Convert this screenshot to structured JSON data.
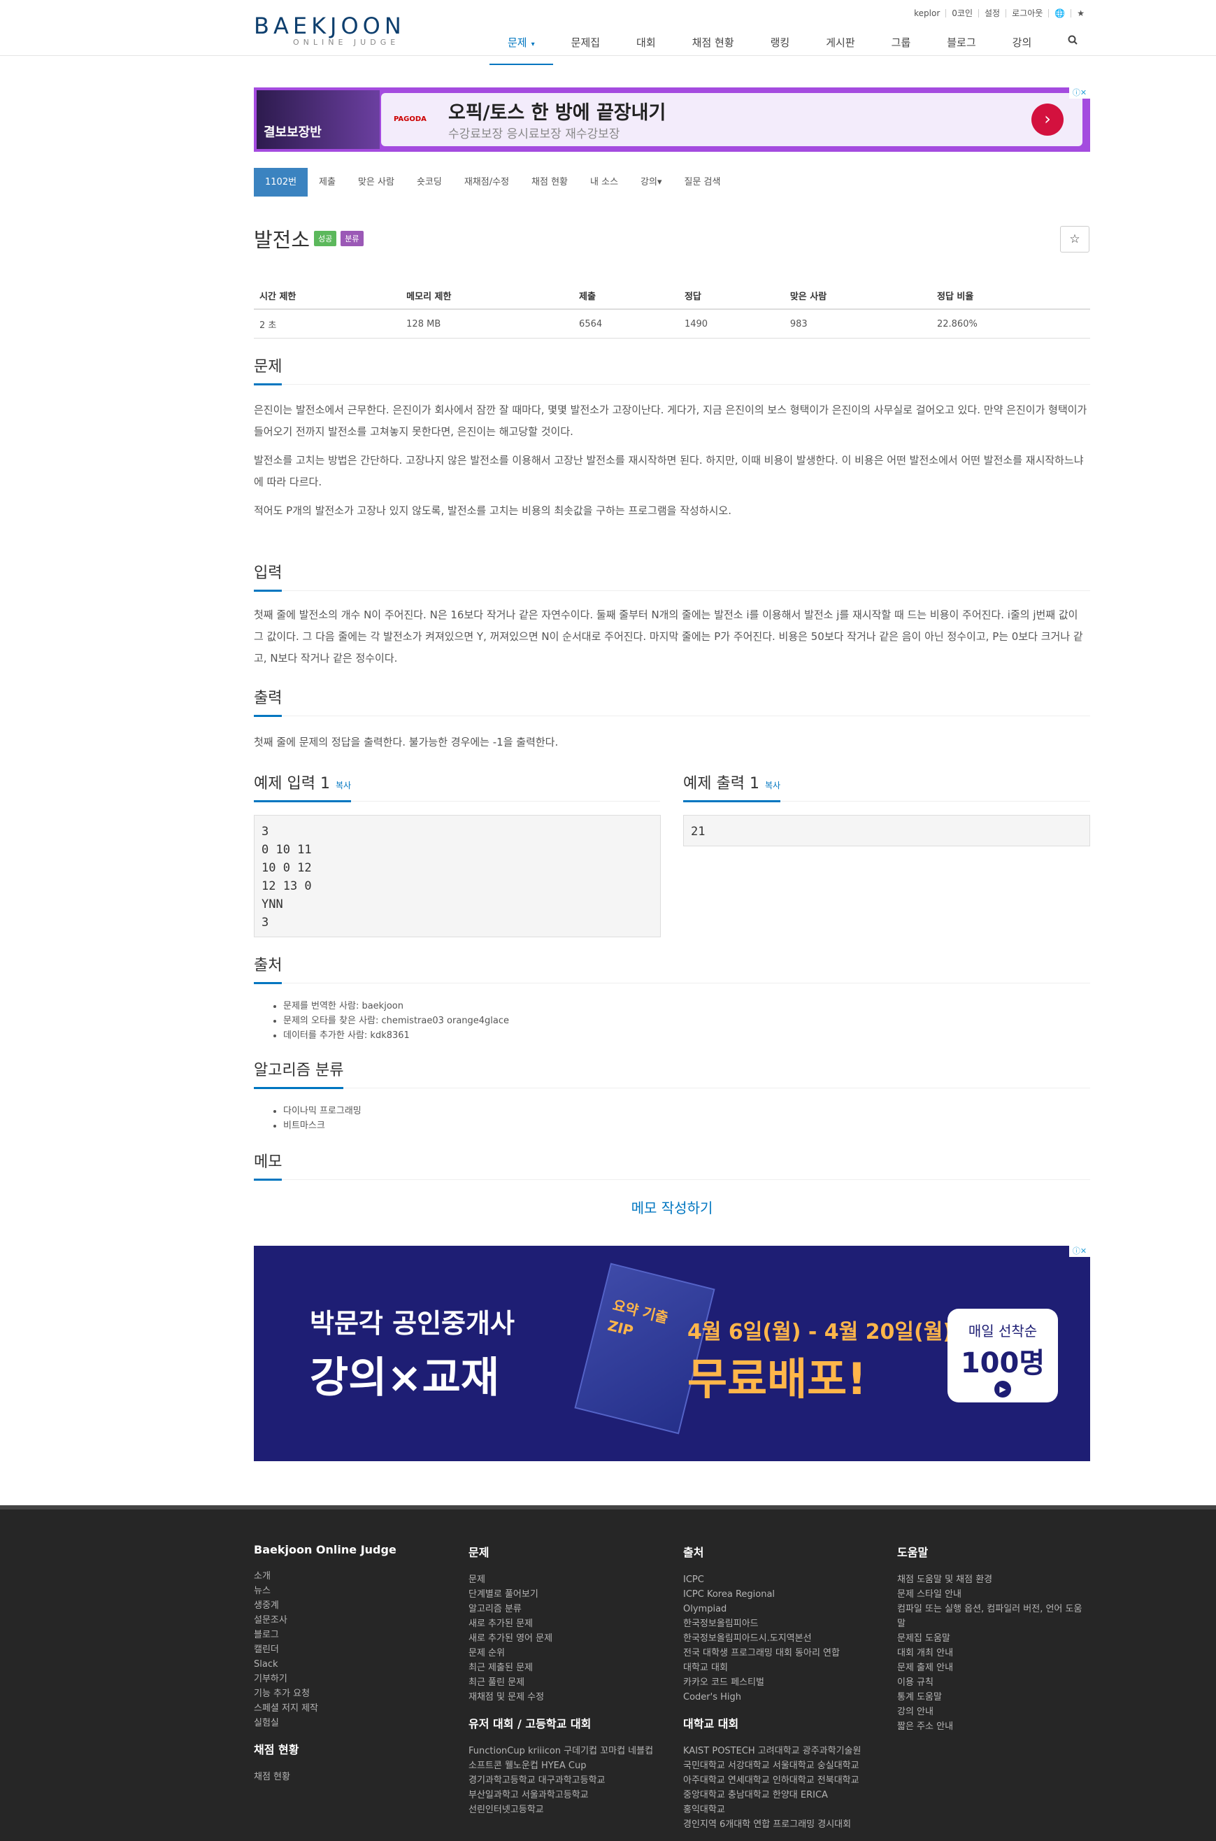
{
  "header": {
    "logo_main": "BAEKJOON",
    "logo_sub": "ONLINE JUDGE",
    "top_links": [
      "keplor",
      "0코인",
      "설정",
      "로그아웃"
    ],
    "nav": [
      "문제",
      "문제집",
      "대회",
      "채점 현황",
      "랭킹",
      "게시판",
      "그룹",
      "블로그",
      "강의"
    ]
  },
  "ad_top": {
    "left_text": "결보보장반",
    "brand": "PAGODA",
    "title": "오픽/토스 한 방에 끝장내기",
    "subtitle": "수강료보장 응시료보장 재수강보장"
  },
  "tabs": [
    "1102번",
    "제출",
    "맞은 사람",
    "숏코딩",
    "재채점/수정",
    "채점 현황",
    "내 소스",
    "강의",
    "질문 검색"
  ],
  "problem": {
    "title": "발전소",
    "badges": [
      "성공",
      "분류"
    ],
    "info_headers": [
      "시간 제한",
      "메모리 제한",
      "제출",
      "정답",
      "맞은 사람",
      "정답 비율"
    ],
    "info_values": [
      "2 초",
      "128 MB",
      "6564",
      "1490",
      "983",
      "22.860%"
    ]
  },
  "sections": {
    "problem_title": "문제",
    "problem_p1": "은진이는 발전소에서 근무한다. 은진이가 회사에서 잠깐 잘 때마다, 몇몇 발전소가 고장이난다. 게다가, 지금 은진이의 보스 형택이가 은진이의 사무실로 걸어오고 있다. 만약 은진이가 형택이가 들어오기 전까지 발전소를 고쳐놓지 못한다면, 은진이는 해고당할 것이다.",
    "problem_p2": "발전소를 고치는 방법은 간단하다. 고장나지 않은 발전소를 이용해서 고장난 발전소를 재시작하면 된다. 하지만, 이때 비용이 발생한다. 이 비용은 어떤 발전소에서 어떤 발전소를 재시작하느냐에 따라 다르다.",
    "problem_p3": "적어도 P개의 발전소가 고장나 있지 않도록, 발전소를 고치는 비용의 최솟값을 구하는 프로그램을 작성하시오.",
    "input_title": "입력",
    "input_p": "첫째 줄에 발전소의 개수 N이 주어진다. N은 16보다 작거나 같은 자연수이다. 둘째 줄부터 N개의 줄에는 발전소 i를 이용해서 발전소 j를 재시작할 때 드는 비용이 주어진다. i줄의 j번째 값이 그 값이다. 그 다음 줄에는 각 발전소가 켜져있으면 Y, 꺼져있으면 N이 순서대로 주어진다. 마지막 줄에는 P가 주어진다. 비용은 50보다 작거나 같은 음이 아닌 정수이고, P는 0보다 크거나 같고, N보다 작거나 같은 정수이다.",
    "output_title": "출력",
    "output_p": "첫째 줄에 문제의 정답을 출력한다. 불가능한 경우에는 -1을 출력한다.",
    "sample_in_title": "예제 입력 1",
    "sample_out_title": "예제 출력 1",
    "copy": "복사",
    "sample_in": "3\n0 10 11\n10 0 12\n12 13 0\nYNN\n3",
    "sample_out": "21",
    "source_title": "출처",
    "source_items": [
      "문제를 번역한 사람: baekjoon",
      "문제의 오타를 찾은 사람: chemistrae03 orange4glace",
      "데이터를 추가한 사람: kdk8361"
    ],
    "algo_title": "알고리즘 분류",
    "algo_items": [
      "다이나믹 프로그래밍",
      "비트마스크"
    ],
    "memo_title": "메모",
    "memo_link": "메모 작성하기"
  },
  "ad_bottom": {
    "line1": "박문각 공인중개사",
    "line2": "강의×교재",
    "line3": "4월 6일(월) - 4월 20일(월)",
    "line4": "무료배포!",
    "badge1": "매일 선착순",
    "badge2": "100명",
    "book": "요약 기출 ZIP"
  },
  "footer": {
    "col1_title": "Baekjoon Online Judge",
    "col1": [
      "소개",
      "뉴스",
      "생중계",
      "설문조사",
      "블로그",
      "캘린더",
      "Slack",
      "기부하기",
      "기능 추가 요청",
      "스페셜 저지 제작",
      "실험실"
    ],
    "col1b_title": "채점 현황",
    "col1b": [
      "채점 현황"
    ],
    "col2_title": "문제",
    "col2": [
      "문제",
      "단계별로 풀어보기",
      "알고리즘 분류",
      "새로 추가된 문제",
      "새로 추가된 영어 문제",
      "문제 순위",
      "최근 제출된 문제",
      "최근 풀린 문제",
      "재채점 및 문제 수정"
    ],
    "col2b_title": "유저 대회 / 고등학교 대회",
    "col2b": [
      "FunctionCup kriiicon 구데기컵 꼬마컵 네블컵",
      "소프트콘 웰노운컵 HYEA Cup",
      "경기과학고등학교 대구과학고등학교",
      "부산일과학고 서울과학고등학교",
      "선린인터넷고등학교"
    ],
    "col3_title": "출처",
    "col3": [
      "ICPC",
      "ICPC Korea Regional",
      "Olympiad",
      "한국정보올림피아드",
      "한국정보올림피아드시.도지역본선",
      "전국 대학생 프로그래밍 대회 동아리 연합",
      "대학교 대회",
      "카카오 코드 페스티벌",
      "Coder's High"
    ],
    "col3b_title": "대학교 대회",
    "col3b": [
      "KAIST POSTECH 고려대학교 광주과학기술원",
      "국민대학교 서강대학교 서울대학교 숭실대학교",
      "아주대학교 연세대학교 인하대학교 전북대학교",
      "중앙대학교 충남대학교 한양대 ERICA",
      "홍익대학교",
      "경인지역 6개대학 연합 프로그래밍 경시대회"
    ],
    "col4_title": "도움말",
    "col4": [
      "채점 도움말 및 채점 환경",
      "문제 스타일 안내",
      "컴파일 또는 실행 옵션, 컴파일러 버전, 언어 도움말",
      "문제집 도움말",
      "대회 개최 안내",
      "문제 출제 안내",
      "이용 규칙",
      "통계 도움말",
      "강의 안내",
      "짧은 주소 안내"
    ]
  }
}
